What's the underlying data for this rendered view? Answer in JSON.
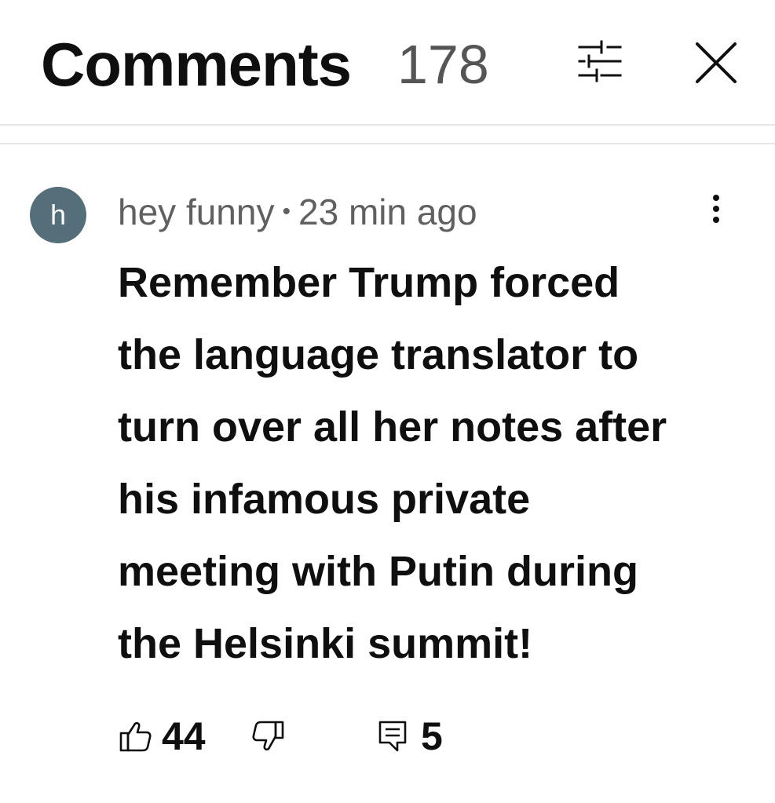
{
  "header": {
    "title": "Comments",
    "count": "178"
  },
  "comment": {
    "avatar_letter": "h",
    "avatar_color": "#546e7a",
    "author": "hey funny",
    "separator": "•",
    "timestamp": "23 min ago",
    "text": "Remember Trump forced\nthe language translator to\nturn over all her notes after\nhis infamous private\nmeeting with Putin during\nthe Helsinki summit!",
    "likes": "44",
    "replies": "5"
  },
  "icons": {
    "filter": "sliders-icon",
    "close": "close-icon",
    "more": "more-vertical-icon",
    "like": "thumbs-up-icon",
    "dislike": "thumbs-down-icon",
    "reply": "comment-icon"
  }
}
